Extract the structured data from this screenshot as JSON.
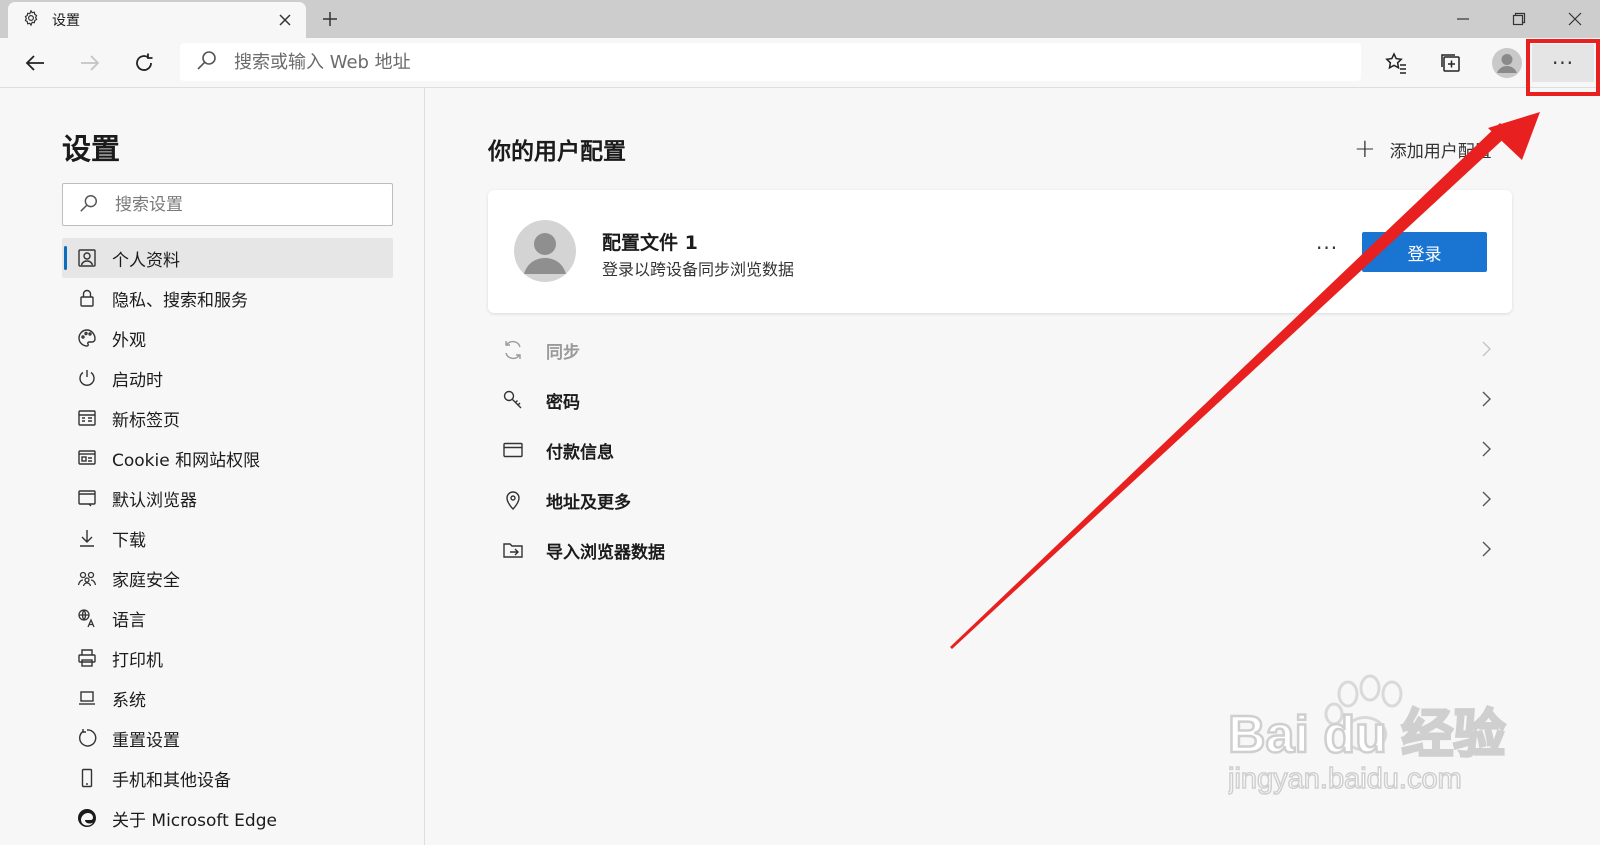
{
  "tab": {
    "title": "设置"
  },
  "toolbar": {
    "address_placeholder": "搜索或输入 Web 地址",
    "more_label": "···"
  },
  "sidebar": {
    "title": "设置",
    "search_placeholder": "搜索设置",
    "items": [
      {
        "label": "个人资料",
        "icon": "profile-icon",
        "active": true
      },
      {
        "label": "隐私、搜索和服务",
        "icon": "lock-icon"
      },
      {
        "label": "外观",
        "icon": "palette-icon"
      },
      {
        "label": "启动时",
        "icon": "power-icon"
      },
      {
        "label": "新标签页",
        "icon": "new-tab-page-icon"
      },
      {
        "label": "Cookie 和网站权限",
        "icon": "site-permissions-icon"
      },
      {
        "label": "默认浏览器",
        "icon": "default-browser-icon"
      },
      {
        "label": "下载",
        "icon": "download-icon"
      },
      {
        "label": "家庭安全",
        "icon": "family-icon"
      },
      {
        "label": "语言",
        "icon": "language-icon"
      },
      {
        "label": "打印机",
        "icon": "printer-icon"
      },
      {
        "label": "系统",
        "icon": "system-icon"
      },
      {
        "label": "重置设置",
        "icon": "reset-icon"
      },
      {
        "label": "手机和其他设备",
        "icon": "phone-icon"
      },
      {
        "label": "关于 Microsoft Edge",
        "icon": "edge-logo-icon"
      }
    ]
  },
  "main": {
    "title": "你的用户配置",
    "add_profile_label": "添加用户配置",
    "profile": {
      "name": "配置文件 1",
      "subtitle": "登录以跨设备同步浏览数据",
      "more_label": "···",
      "signin_label": "登录"
    },
    "rows": [
      {
        "label": "同步",
        "icon": "sync-icon",
        "disabled": true
      },
      {
        "label": "密码",
        "icon": "key-icon"
      },
      {
        "label": "付款信息",
        "icon": "card-icon"
      },
      {
        "label": "地址及更多",
        "icon": "location-pin-icon"
      },
      {
        "label": "导入浏览器数据",
        "icon": "import-folder-icon"
      }
    ]
  },
  "watermark": {
    "brand": "Bai du 经验",
    "url": "jingyan.baidu.com"
  },
  "colors": {
    "accent": "#1a74d2",
    "annotation": "#e8201f",
    "active_indicator": "#0f6cbd"
  }
}
